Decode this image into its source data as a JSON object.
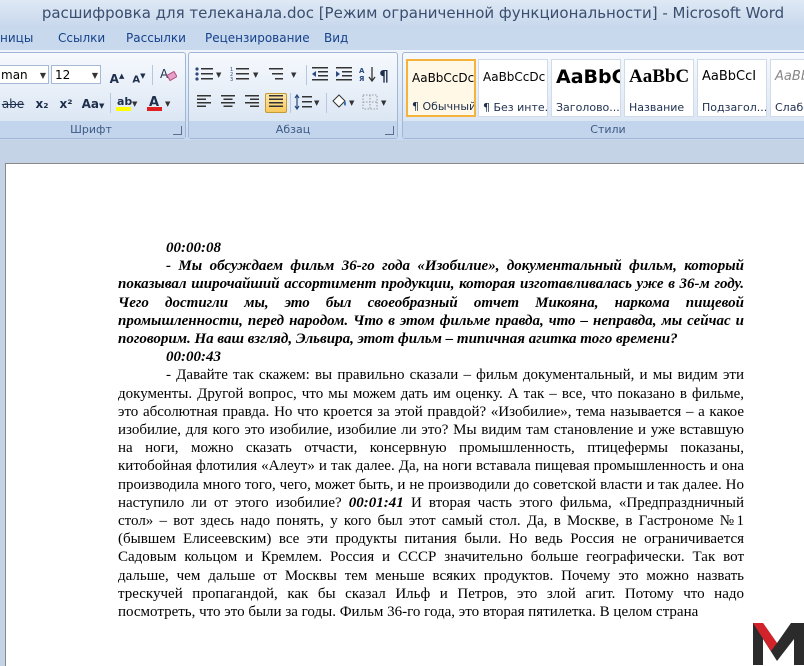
{
  "window": {
    "title": "расшифровка для телеканала.doc [Режим ограниченной функциональности] - Microsoft Word"
  },
  "tabs": [
    "ницы",
    "Ссылки",
    "Рассылки",
    "Рецензирование",
    "Вид"
  ],
  "font_group": {
    "label": "Шрифт",
    "font_name": "man",
    "font_size": "12",
    "grow_label": "A",
    "shrink_label": "A",
    "strike_label": "abe",
    "sub_label": "x₂",
    "sup_label": "x²",
    "case_label": "Aa",
    "font_color_label": "A",
    "highlight_color": "#ffff00",
    "font_color": "#e02020"
  },
  "paragraph_group": {
    "label": "Абзац"
  },
  "styles_group": {
    "label": "Стили",
    "styles": [
      {
        "sample": "AaBbCcDc",
        "name": "¶ Обычный"
      },
      {
        "sample": "AaBbCcDc",
        "name": "¶ Без инте..."
      },
      {
        "sample": "AaBbC",
        "name": "Заголово..."
      },
      {
        "sample": "AaBbC",
        "name": "Название"
      },
      {
        "sample": "AaBbCcI",
        "name": "Подзагол..."
      },
      {
        "sample": "AaBb",
        "name": "Слабо"
      }
    ]
  },
  "document": {
    "ts1": "00:00:08",
    "q1": "- Мы обсуждаем фильм 36-го года «Изобилие», документальный фильм, который показывал широчайший ассортимент продукции, которая изготавливалась уже в 36-м году. Чего достигли мы, это был своеобразный отчет Микояна, наркома пищевой промышленности, перед народом. Что в этом фильме правда, что – неправда, мы сейчас и поговорим. На ваш взгляд, Эльвира, этот фильм – типичная агитка того времени?",
    "ts2": "00:00:43",
    "a1_part1": "- Давайте так скажем: вы правильно сказали – фильм документальный, и мы видим эти документы. Другой вопрос, что мы можем дать им оценку. А так – все, что показано в фильме, это абсолютная правда. Но что кроется за этой правдой? «Изобилие», тема называется – а какое изобилие, для кого это изобилие, изобилие ли это? Мы видим там становление и уже вставшую на ноги, можно сказать отчасти, консервную промышленность, птицефермы показаны, китобойная флотилия «Алеут» и так далее. Да, на ноги вставала пищевая промышленность и она производила много того, чего, может быть, и не производили до советской власти и так далее. Но наступило ли от этого изобилие?",
    "ts3": "00:01:41",
    "a1_part2": "И вторая часть этого фильма, «Предпраздничный стол» – вот здесь надо понять, у кого был этот самый стол. Да, в Москве, в Гастрономе №1 (бывшем Елисеевским) все эти продукты питания были. Но ведь Россия не ограничивается Садовым кольцом и Кремлем. Россия и СССР значительно больше географически. Так вот дальше, чем дальше от Москвы  тем меньше всяких продуктов. Почему это можно назвать трескучей пропагандой, как бы сказал Ильф и Петров, это злой агит. Потому что надо посмотреть, что это были за годы. Фильм 36-го года, это вторая пятилетка. В целом страна"
  },
  "colors": {
    "logo_red": "#d2232a",
    "logo_dark": "#2b2b2b"
  }
}
